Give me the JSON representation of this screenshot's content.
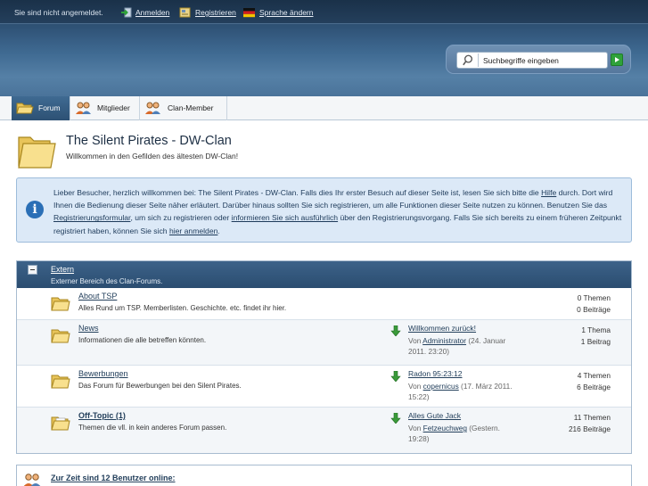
{
  "userbar": {
    "status": "Sie sind nicht angemeldet.",
    "login": "Anmelden",
    "register": "Registrieren",
    "language": "Sprache ändern"
  },
  "search": {
    "placeholder": "Suchbegriffe eingeben"
  },
  "tabs": [
    {
      "label": "Forum",
      "active": true,
      "icon": "folder-icon"
    },
    {
      "label": "Mitglieder",
      "active": false,
      "icon": "members-icon"
    },
    {
      "label": "Clan-Member",
      "active": false,
      "icon": "members-icon"
    }
  ],
  "page": {
    "title": "The Silent Pirates - DW-Clan",
    "subtitle": "Willkommen in den Gefilden des ältesten DW-Clan!"
  },
  "info": {
    "t1": "Lieber Besucher, herzlich willkommen bei: The Silent Pirates - DW-Clan. Falls dies Ihr erster Besuch auf dieser Seite ist, lesen Sie sich bitte die ",
    "help": "Hilfe",
    "t2": " durch. Dort wird Ihnen die Bedienung dieser Seite näher erläutert. Darüber hinaus sollten Sie sich registrieren, um alle Funktionen dieser Seite nutzen zu können. Benutzen Sie das ",
    "regform": "Registrierungsformular",
    "t3": ", um sich zu registrieren oder ",
    "moreinfo": "informieren Sie sich ausführlich",
    "t4": " über den Registrierungsvorgang. Falls Sie sich bereits zu einem früheren Zeitpunkt registriert haben, können Sie sich ",
    "loginhere": "hier anmelden",
    "t5": "."
  },
  "category": {
    "title": "Extern",
    "desc": "Externer Bereich des Clan-Forums."
  },
  "boards": [
    {
      "title": "About TSP",
      "desc": "Alles Rund um TSP. Memberlisten. Geschichte. etc. findet ihr hier.",
      "last_title": "",
      "by": "",
      "author": "",
      "date": "",
      "threads": "0 Themen",
      "posts": "0 Beiträge"
    },
    {
      "title": "News",
      "desc": "Informationen die alle betreffen könnten.",
      "last_title": "Willkommen zurück!",
      "by": "Von ",
      "author": "Administrator",
      "date": " (24. Januar 2011. 23:20)",
      "threads": "1 Thema",
      "posts": "1 Beitrag"
    },
    {
      "title": "Bewerbungen",
      "desc": "Das Forum für Bewerbungen bei den Silent Pirates.",
      "last_title": "Radon 95:23:12",
      "by": "Von ",
      "author": "copernicus",
      "date": " (17. März 2011. 15:22)",
      "threads": "4 Themen",
      "posts": "6 Beiträge"
    },
    {
      "title": "Off-Topic (1)",
      "desc": "Themen die vll. in kein anderes Forum passen.",
      "last_title": "Alles Gute Jack",
      "by": "Von ",
      "author": "Fetzeuchweg",
      "date": " (Gestern. 19:28)",
      "threads": "11 Themen",
      "posts": "216 Beiträge"
    }
  ],
  "online": {
    "title": "Zur Zeit sind 12 Benutzer online:"
  },
  "colors": {
    "header": "#2f5276",
    "link": "#24405c",
    "info_bg": "#dce9f7"
  }
}
